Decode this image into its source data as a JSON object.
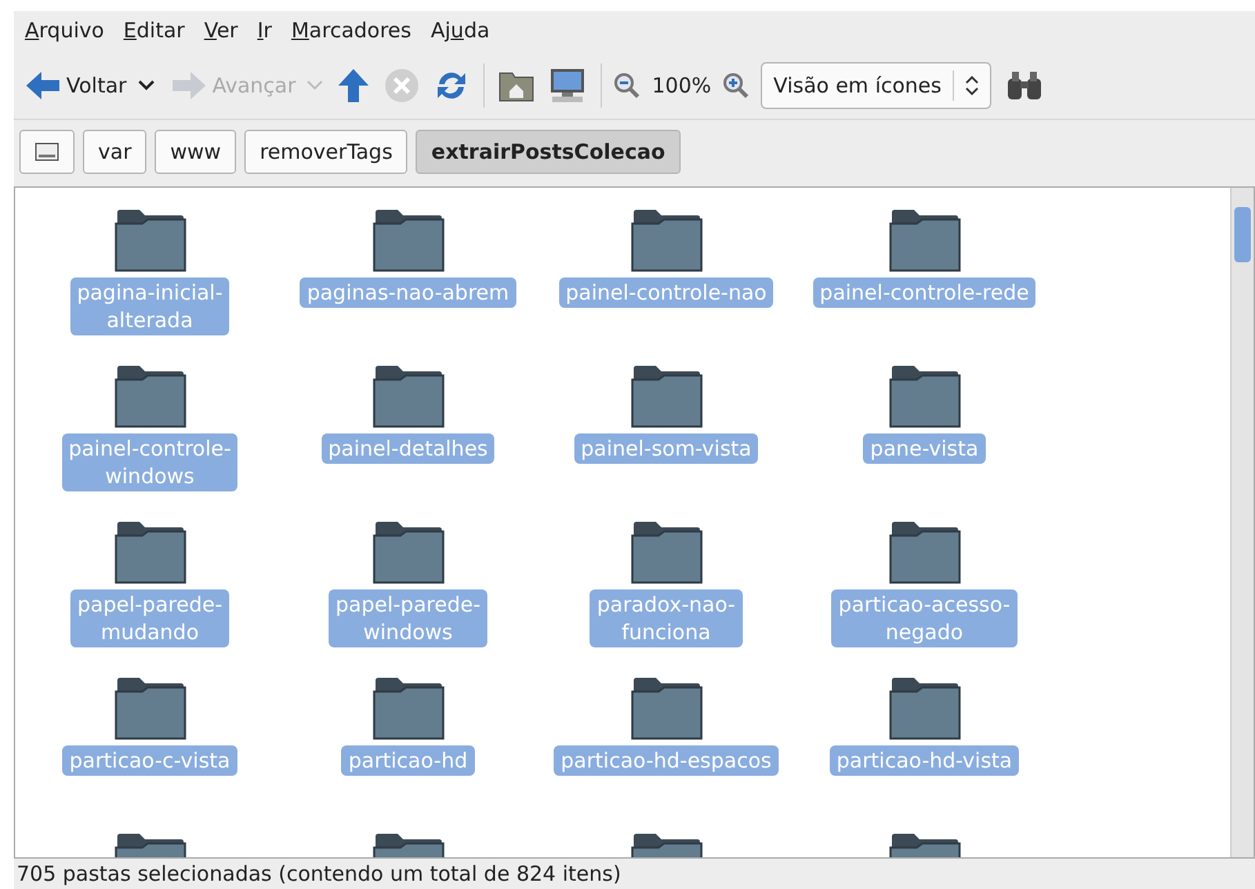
{
  "menu": [
    {
      "underlined": "A",
      "after": "rquivo"
    },
    {
      "underlined": "E",
      "after": "ditar"
    },
    {
      "underlined": "V",
      "after": "er"
    },
    {
      "underlined": "I",
      "after": "r"
    },
    {
      "underlined": "M",
      "after": "arcadores"
    },
    {
      "before": "Aj",
      "underlined": "u",
      "after": "da"
    }
  ],
  "toolbar": {
    "back": {
      "label": "Voltar",
      "disabled": false
    },
    "forward": {
      "label": "Avançar",
      "disabled": true
    },
    "stop_disabled": true,
    "zoom": "100%",
    "view_select": "Visão em ícones"
  },
  "path": [
    {
      "kind": "drive",
      "selected": false
    },
    {
      "kind": "dir",
      "label": "var",
      "selected": false
    },
    {
      "kind": "dir",
      "label": "www",
      "selected": false
    },
    {
      "kind": "dir",
      "label": "removerTags",
      "selected": false
    },
    {
      "kind": "dir",
      "label": "extrairPostsColecao",
      "selected": true
    }
  ],
  "items": [
    {
      "kind": "folder",
      "lines": [
        "pagina-inicial-",
        "alterada"
      ],
      "selected": true
    },
    {
      "kind": "folder",
      "lines": [
        "paginas-nao-abrem"
      ],
      "selected": true
    },
    {
      "kind": "folder",
      "lines": [
        "painel-controle-nao"
      ],
      "selected": true
    },
    {
      "kind": "folder",
      "lines": [
        "painel-controle-rede"
      ],
      "selected": true
    },
    {
      "kind": "folder",
      "lines": [
        "painel-controle-",
        "windows"
      ],
      "selected": true
    },
    {
      "kind": "folder",
      "lines": [
        "painel-detalhes"
      ],
      "selected": true
    },
    {
      "kind": "folder",
      "lines": [
        "painel-som-vista"
      ],
      "selected": true
    },
    {
      "kind": "folder",
      "lines": [
        "pane-vista"
      ],
      "selected": true
    },
    {
      "kind": "folder",
      "lines": [
        "papel-parede-",
        "mudando"
      ],
      "selected": true
    },
    {
      "kind": "folder",
      "lines": [
        "papel-parede-",
        "windows"
      ],
      "selected": true
    },
    {
      "kind": "folder",
      "lines": [
        "paradox-nao-",
        "funciona"
      ],
      "selected": true
    },
    {
      "kind": "folder",
      "lines": [
        "particao-acesso-",
        "negado"
      ],
      "selected": true
    },
    {
      "kind": "folder",
      "lines": [
        "particao-c-vista"
      ],
      "selected": true
    },
    {
      "kind": "folder",
      "lines": [
        "particao-hd"
      ],
      "selected": true
    },
    {
      "kind": "folder",
      "lines": [
        "particao-hd-espacos"
      ],
      "selected": true
    },
    {
      "kind": "folder",
      "lines": [
        "particao-hd-vista"
      ],
      "selected": true
    },
    {
      "kind": "cut"
    },
    {
      "kind": "cut"
    },
    {
      "kind": "cut"
    },
    {
      "kind": "cut"
    }
  ],
  "status_bar": "705 pastas selecionadas (contendo um total de 824 itens)"
}
